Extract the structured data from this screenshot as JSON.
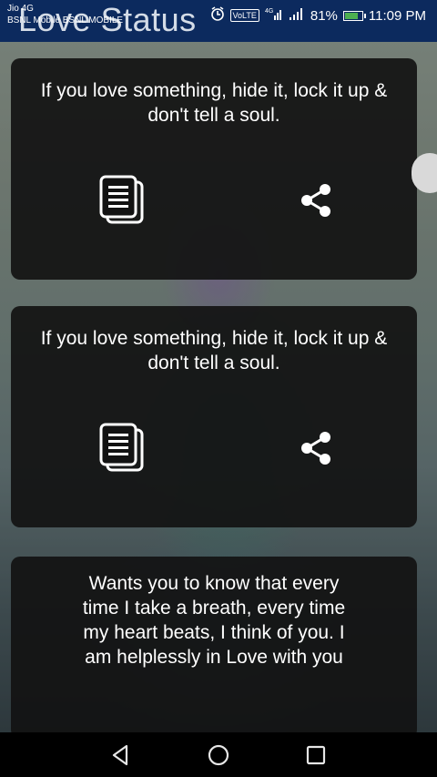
{
  "app": {
    "title": "Love Status"
  },
  "statusbar": {
    "carrier_line1": "Jio 4G",
    "carrier_line2": "BSNL Mobile BSNL MOBILE",
    "volte": "VoLTE",
    "battery_percent": "81%",
    "battery_level": 0.81,
    "time": "11:09 PM"
  },
  "cards": [
    {
      "text": "If you love something, hide it, lock it up & don't tell a soul."
    },
    {
      "text": "If you love something, hide it, lock it up & don't tell a soul."
    },
    {
      "text": "Wants you to know that every time I take a breath, every time my heart beats, I think of you. I am helplessly in Love with you"
    }
  ],
  "icons": {
    "copy": "copy-icon",
    "share": "share-icon",
    "back": "back-icon",
    "home": "home-icon",
    "recent": "recent-apps-icon"
  },
  "colors": {
    "statusbar": "#0c2a5e",
    "card": "#121212",
    "battery_fill": "#4caf50"
  }
}
